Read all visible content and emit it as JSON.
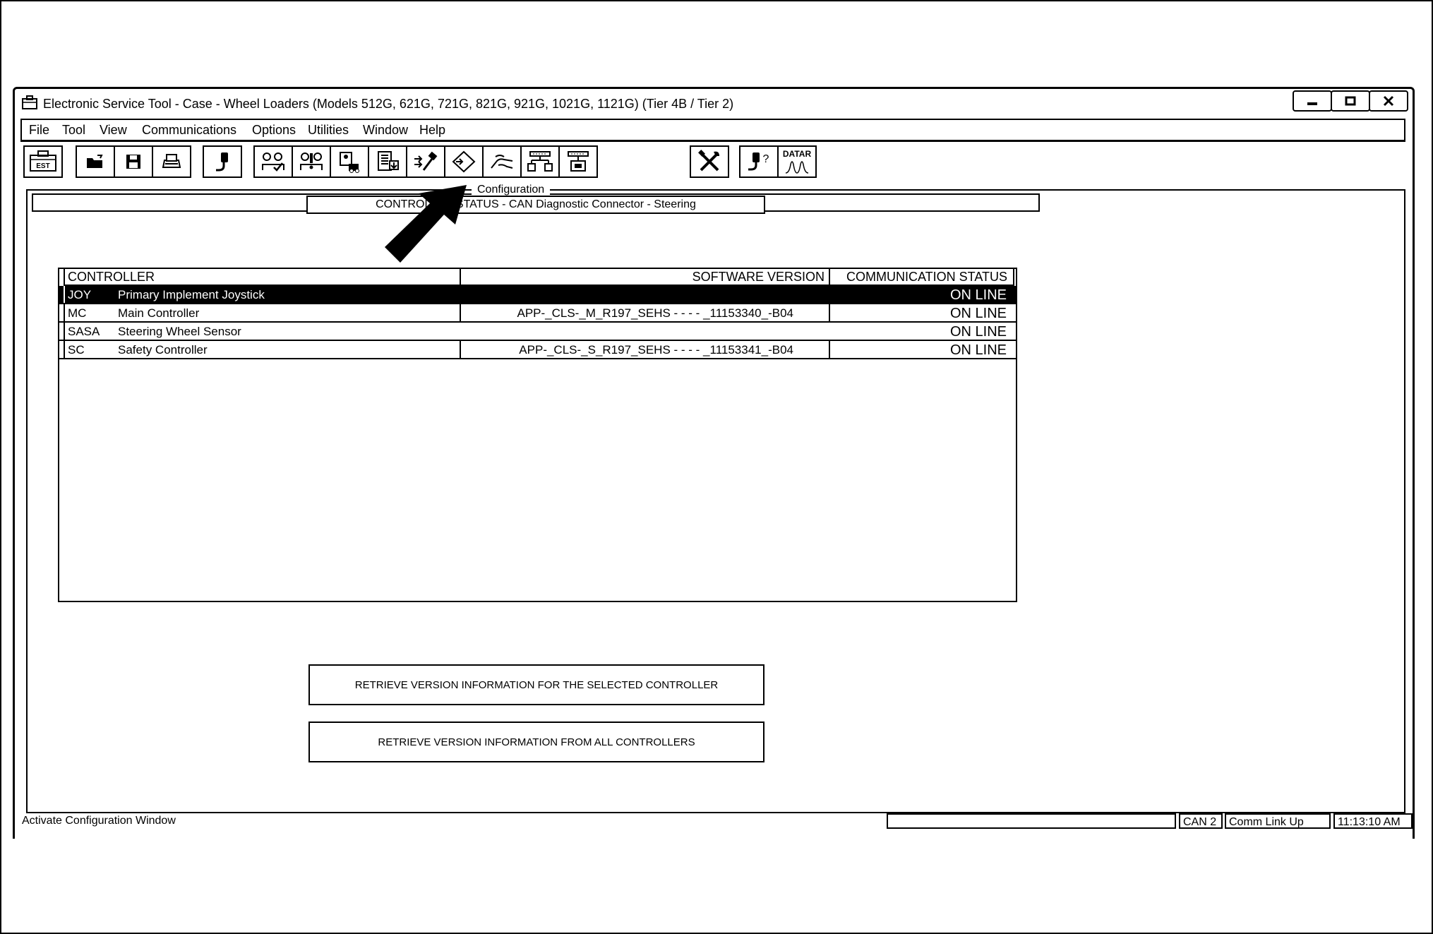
{
  "window": {
    "title": "Electronic Service Tool - Case - Wheel Loaders (Models 512G, 621G, 721G, 821G, 921G, 1021G, 1121G) (Tier 4B / Tier 2)"
  },
  "menu": {
    "items": [
      {
        "label": "File"
      },
      {
        "label": "Tool"
      },
      {
        "label": "View"
      },
      {
        "label": "Communications"
      },
      {
        "label": "Options"
      },
      {
        "label": "Utilities"
      },
      {
        "label": "Window"
      },
      {
        "label": "Help"
      }
    ]
  },
  "toolbar": {
    "est_label": "EST",
    "datar_label": "DATAR"
  },
  "panel": {
    "config_label": "Configuration",
    "status_text": "CONTROLLER STATUS - CAN Diagnostic Connector - Steering"
  },
  "table": {
    "headers": {
      "controller": "CONTROLLER",
      "software_version": "SOFTWARE VERSION",
      "communication_status": "COMMUNICATION STATUS"
    },
    "rows": [
      {
        "id": "JOY",
        "name": "Primary Implement Joystick",
        "version": "",
        "status": "ON LINE"
      },
      {
        "id": "MC",
        "name": "Main Controller",
        "version": "APP-_CLS-_M_R197_SEHS - - - - _11153340_-B04",
        "status": "ON LINE"
      },
      {
        "id": "SASA",
        "name": "Steering Wheel Sensor",
        "version": "",
        "status": "ON LINE"
      },
      {
        "id": "SC",
        "name": "Safety Controller",
        "version": "APP-_CLS-_S_R197_SEHS - - - - _11153341_-B04",
        "status": "ON LINE"
      }
    ]
  },
  "buttons": {
    "retrieve_selected": "RETRIEVE VERSION INFORMATION FOR THE SELECTED CONTROLLER",
    "retrieve_all": "RETRIEVE VERSION INFORMATION FROM ALL CONTROLLERS"
  },
  "statusbar": {
    "message": "Activate Configuration Window",
    "channel": "CAN 2",
    "link": "Comm Link Up",
    "time": "11:13:10 AM"
  }
}
